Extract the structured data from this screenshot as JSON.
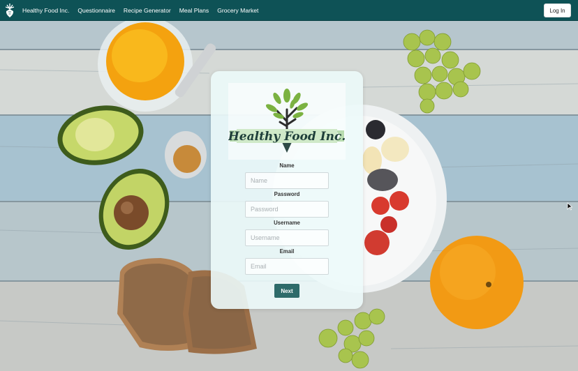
{
  "navbar": {
    "brand": "Healthy Food Inc.",
    "links": [
      "Questionnaire",
      "Recipe Generator",
      "Meal Plans",
      "Grocery Market"
    ],
    "login_label": "Log In"
  },
  "form": {
    "logo_text": "Healthy Food Inc.",
    "fields": [
      {
        "label": "Name",
        "placeholder": "Name",
        "value": ""
      },
      {
        "label": "Password",
        "placeholder": "Password",
        "value": ""
      },
      {
        "label": "Username",
        "placeholder": "Username",
        "value": ""
      },
      {
        "label": "Email",
        "placeholder": "Email",
        "value": ""
      }
    ],
    "submit_label": "Next"
  },
  "colors": {
    "navbar": "#0e5256",
    "button": "#2e6b6a",
    "logo_text": "#1f3f3a",
    "logo_banner": "#cfe9c8",
    "leaf": "#7bb241"
  }
}
